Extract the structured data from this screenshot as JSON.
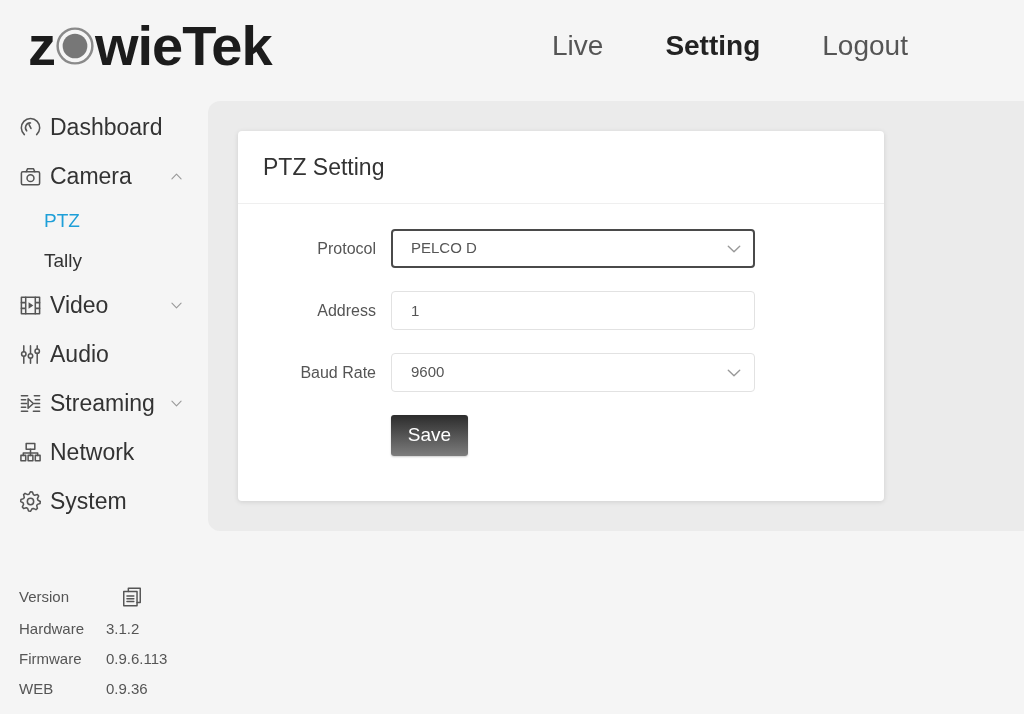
{
  "logo": {
    "text_start": "z",
    "text_end": "wieTek"
  },
  "top_nav": [
    {
      "label": "Live",
      "selected": false
    },
    {
      "label": "Setting",
      "selected": true
    },
    {
      "label": "Logout",
      "selected": false
    }
  ],
  "sidebar": {
    "items": [
      {
        "label": "Dashboard",
        "selected": false
      },
      {
        "label": "Camera",
        "selected": false,
        "expanded": true,
        "children": [
          {
            "label": "PTZ",
            "selected": true
          },
          {
            "label": "Tally",
            "selected": false
          }
        ]
      },
      {
        "label": "Video",
        "selected": false,
        "expanded": false
      },
      {
        "label": "Audio",
        "selected": false
      },
      {
        "label": "Streaming",
        "selected": false,
        "expanded": false
      },
      {
        "label": "Network",
        "selected": false
      },
      {
        "label": "System",
        "selected": false
      }
    ]
  },
  "version": {
    "title": "Version",
    "rows": [
      {
        "label": "Hardware",
        "value": "3.1.2"
      },
      {
        "label": "Firmware",
        "value": "0.9.6.113"
      },
      {
        "label": "WEB",
        "value": "0.9.36"
      }
    ]
  },
  "ptz_card": {
    "title": "PTZ Setting",
    "fields": [
      {
        "kind": "select",
        "label": "Protocol",
        "value": "PELCO D",
        "focused": true
      },
      {
        "kind": "input",
        "label": "Address",
        "value": "1",
        "focused": false
      },
      {
        "kind": "select",
        "label": "Baud Rate",
        "value": "9600",
        "focused": false
      }
    ],
    "save_button": "Save"
  }
}
